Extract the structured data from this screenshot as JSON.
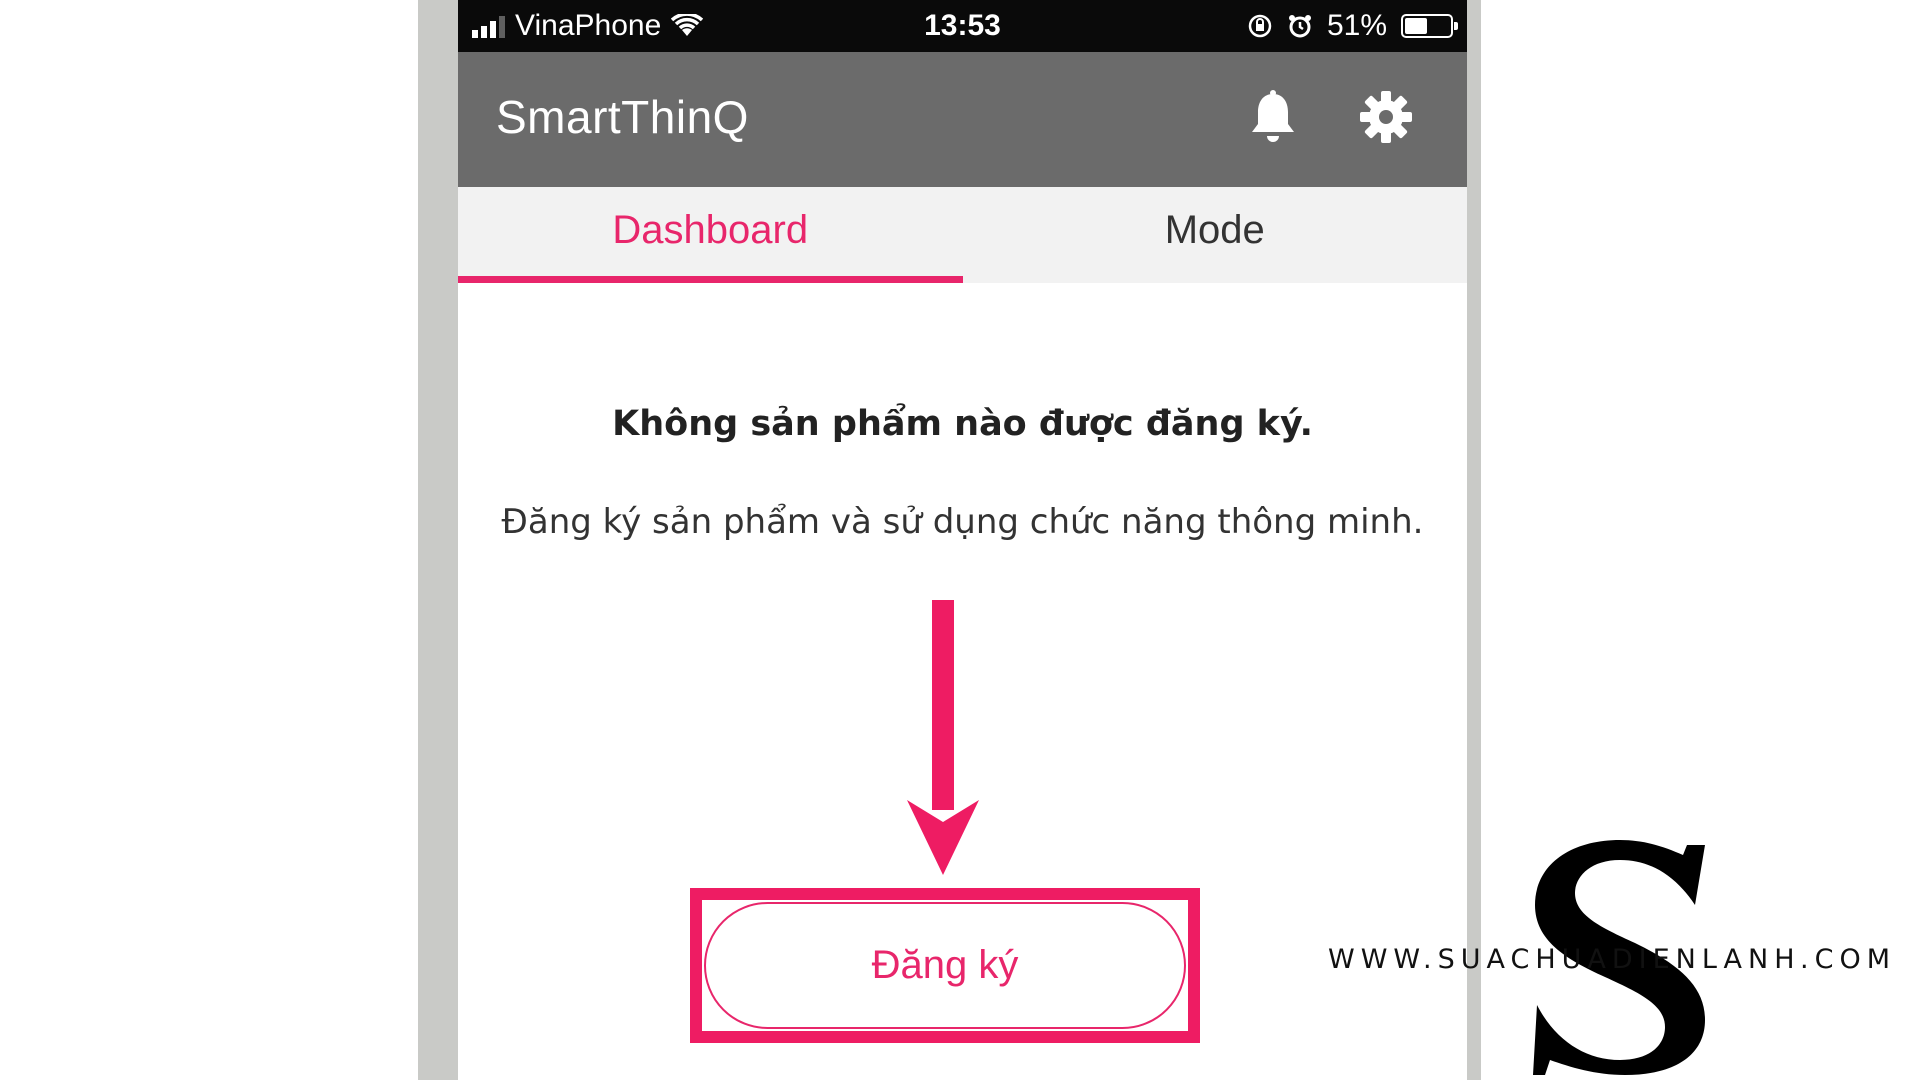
{
  "status_bar": {
    "carrier": "VinaPhone",
    "time": "13:53",
    "battery_text": "51%",
    "battery_level": 0.51
  },
  "header": {
    "title": "SmartThinQ",
    "icons": [
      "bell-icon",
      "gear-icon"
    ]
  },
  "tabs": [
    {
      "label": "Dashboard",
      "active": true
    },
    {
      "label": "Mode",
      "active": false
    }
  ],
  "empty_state": {
    "title": "Không sản phẩm nào được đăng ký.",
    "description": "Đăng ký sản phẩm và sử dụng chức năng thông minh."
  },
  "register_button": {
    "label": "Đăng ký"
  },
  "watermark": {
    "text": "WWW.SUACHUADIENLANH.COM",
    "logo_letter": "S"
  },
  "colors": {
    "accent": "#e8266b",
    "highlight": "#ee1c63",
    "appbar": "#6b6b6b",
    "statusbar": "#0a0a0a"
  }
}
